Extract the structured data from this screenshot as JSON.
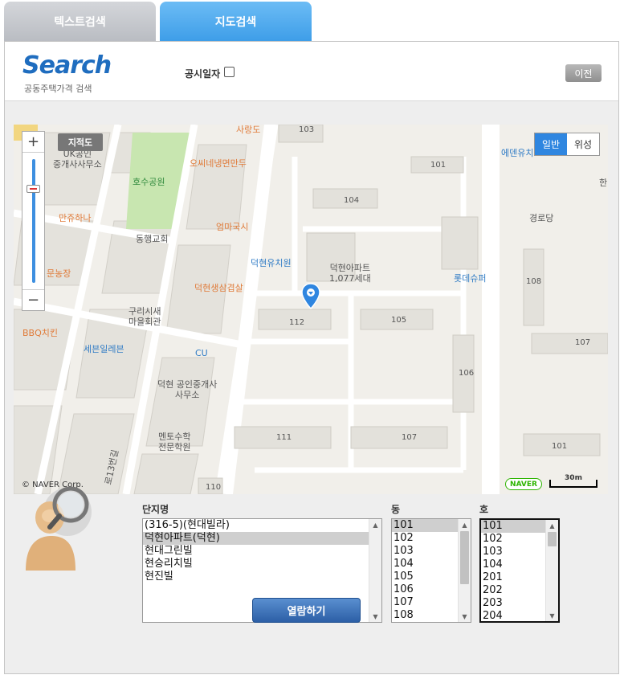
{
  "tabs": [
    {
      "label": "텍스트검색",
      "active": false
    },
    {
      "label": "지도검색",
      "active": true
    }
  ],
  "header": {
    "logo": "Search",
    "logo_sub": "공동주택가격 검색",
    "public_date_label": "공시일자",
    "public_date_checked": false,
    "prev_label": "이전"
  },
  "map": {
    "cadastral_label": "지적도",
    "type_normal": "일반",
    "type_satellite": "위성",
    "copyright": "© NAVER Corp.",
    "naver_badge": "NAVER",
    "scale_label": "30m",
    "labels": {
      "sarangdo": "사랑도",
      "uk": "UK공인\n중개사사무소",
      "hosu": "호수공원",
      "ossine": "오씨네냉면만두",
      "manjuhana": "만쥬하나",
      "donghaeng": "동행교회",
      "eommagukshi": "엄마국시",
      "munnongjang": "문농장",
      "deokhyeon_kinder": "덕현유치원",
      "deokhyeon_apt": "덕현아파트\n1,077세대",
      "deokhyeon_bbq": "덕현생삼겹살",
      "lotte": "롯데슈퍼",
      "bbq": "BBQ치킨",
      "gurisi": "구리시새\n마을회관",
      "seven": "세븐일레븐",
      "cu": "CU",
      "deokhyeon_realty": "덕현 공인중개사\n사무소",
      "mento": "멘토수학\n전문학원",
      "edenyu": "에덴유치",
      "gyeongrodang": "경로당",
      "han": "한",
      "road": "로13번길",
      "bldg_103": "103",
      "bldg_101a": "101",
      "bldg_104": "104",
      "bldg_112": "112",
      "bldg_105": "105",
      "bldg_106": "106",
      "bldg_111": "111",
      "bldg_107a": "107",
      "bldg_108": "108",
      "bldg_107b": "107",
      "bldg_101b": "101",
      "bldg_110": "110"
    }
  },
  "selectors": {
    "complex_label": "단지명",
    "dong_label": "동",
    "ho_label": "호",
    "complexes": [
      {
        "name": "(316-5)(현대빌라)",
        "selected": false
      },
      {
        "name": "덕현아파트(덕현)",
        "selected": true
      },
      {
        "name": "현대그린빌",
        "selected": false
      },
      {
        "name": "현승리치빌",
        "selected": false
      },
      {
        "name": "현진빌",
        "selected": false
      }
    ],
    "dongs": [
      {
        "name": "101",
        "selected": true
      },
      {
        "name": "102",
        "selected": false
      },
      {
        "name": "103",
        "selected": false
      },
      {
        "name": "104",
        "selected": false
      },
      {
        "name": "105",
        "selected": false
      },
      {
        "name": "106",
        "selected": false
      },
      {
        "name": "107",
        "selected": false
      },
      {
        "name": "108",
        "selected": false
      }
    ],
    "hos": [
      {
        "name": "101",
        "selected": true
      },
      {
        "name": "102",
        "selected": false
      },
      {
        "name": "103",
        "selected": false
      },
      {
        "name": "104",
        "selected": false
      },
      {
        "name": "201",
        "selected": false
      },
      {
        "name": "202",
        "selected": false
      },
      {
        "name": "203",
        "selected": false
      },
      {
        "name": "204",
        "selected": false
      }
    ]
  },
  "view_button": "열람하기",
  "colors": {
    "tab_active": "#4aa8ee",
    "tab_inactive": "#c6c8cc",
    "logo": "#1f6dbf",
    "view_button": "#3a6fb8",
    "map_type_active": "#2f86e0"
  }
}
